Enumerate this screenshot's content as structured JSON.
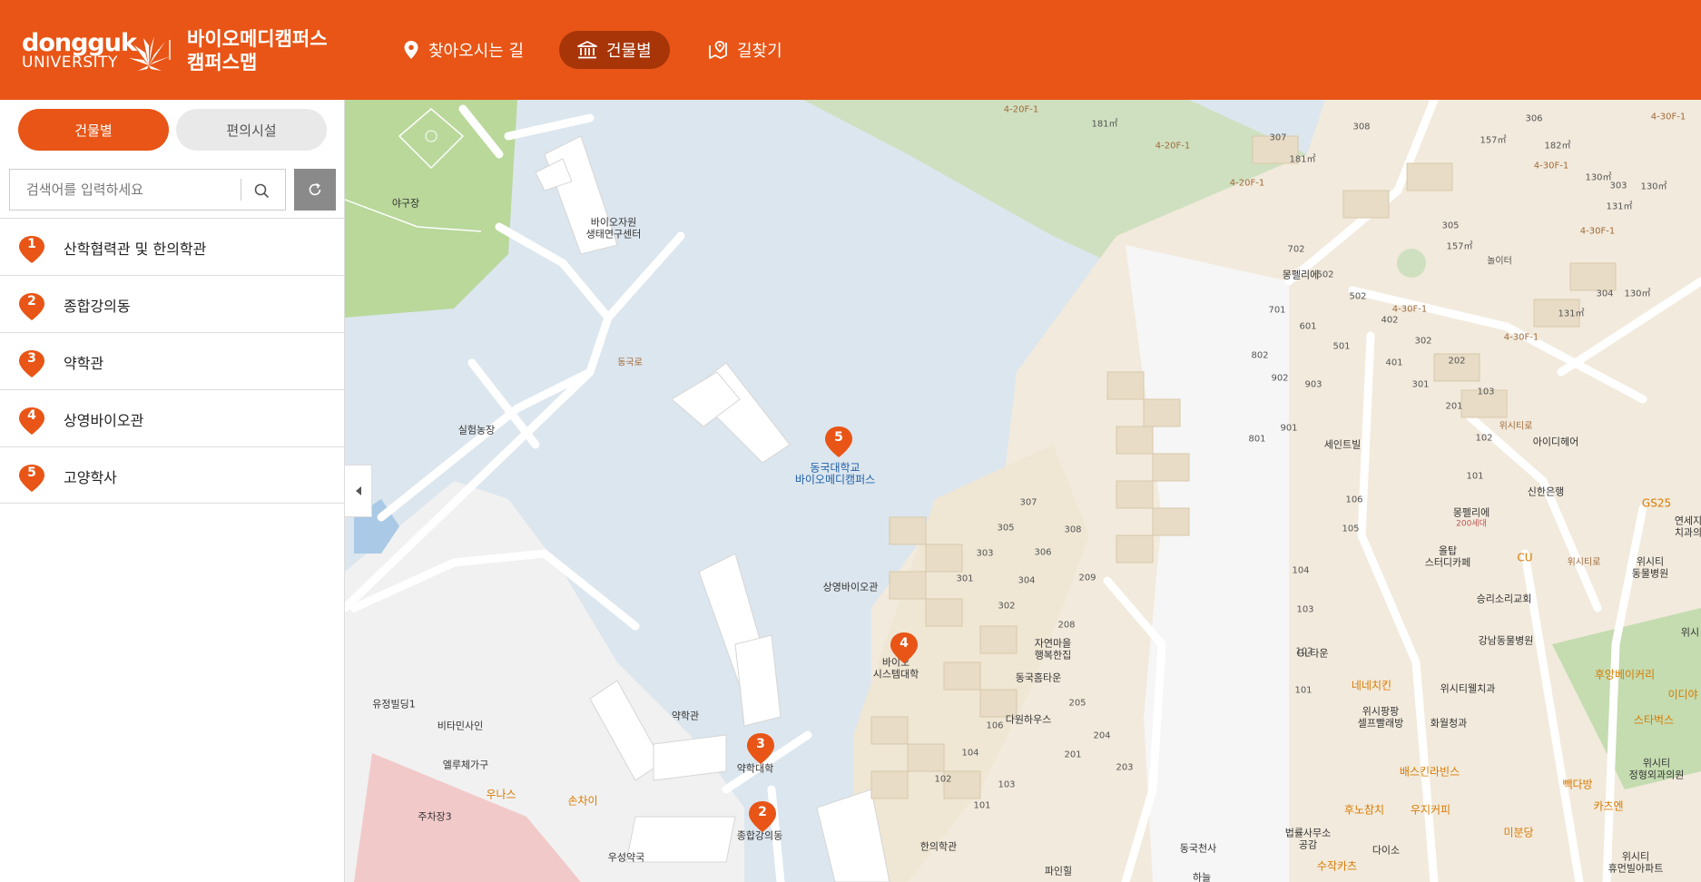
{
  "header": {
    "logo_main": "dongguk",
    "logo_sub": "UNIVERSITY",
    "title_line1": "바이오메디캠퍼스",
    "title_line2": "캠퍼스맵",
    "nav": {
      "directions": "찾아오시는 길",
      "buildings": "건물별",
      "route": "길찾기"
    }
  },
  "sidebar": {
    "tabs": {
      "buildings": "건물별",
      "amenities": "편의시설"
    },
    "search_placeholder": "검색어를 입력하세요",
    "items": [
      {
        "num": "1",
        "label": "산학협력관 및 한의학관"
      },
      {
        "num": "2",
        "label": "종합강의동"
      },
      {
        "num": "3",
        "label": "약학관"
      },
      {
        "num": "4",
        "label": "상영바이오관"
      },
      {
        "num": "5",
        "label": "고양학사"
      }
    ]
  },
  "map": {
    "markers": [
      "5",
      "4",
      "3",
      "2"
    ],
    "labels": {
      "baseball": "야구장",
      "bio_res1": "바이오자원",
      "bio_res2": "생태연구센터",
      "farm": "실험농장",
      "campus1": "동국대학교",
      "campus2": "바이오메디캠퍼스",
      "sangyoung": "상영바이오관",
      "biosys1": "바이오",
      "biosys2": "시스템대학",
      "pharm_hall": "약학관",
      "pharm_college": "약학대학",
      "lecture": "종합강의동",
      "oriental": "한의학관",
      "yujeong": "유정빌딩1",
      "vitamin": "비타민사인",
      "elle": "엘루체가구",
      "unas": "우나스",
      "sonchai": "손차이",
      "parking": "주차장3",
      "woosung": "우성약국",
      "dongguk_rd": "동국로",
      "jayeon1": "자연마을",
      "jayeon2": "행복한집",
      "donggukhome": "동국홈타운",
      "dawon": "다원하우스",
      "dongguk_church": "동국천사",
      "pine": "파인힐",
      "law1": "법률사무소",
      "law2": "공감",
      "daiso": "다이소",
      "sujak": "수작카츠",
      "montpellier": "몽펠리에",
      "montpellier200": "몽펠리에",
      "montpellier200_sub": "200세대",
      "seintrill": "세인트빌",
      "idhair": "아이디헤어",
      "shinhan": "신한은행",
      "gs25": "GS25",
      "cu": "CU",
      "olltap1": "올탑",
      "olltap2": "스터디카페",
      "wisity_animal1": "위시티",
      "wisity_animal2": "동물병원",
      "seungri": "승리소리교회",
      "gangnam_animal": "강남동물병원",
      "gl": "GL타운",
      "nene": "네네치킨",
      "wisity_welfare": "위시티웰치과",
      "wisipang1": "위시팡팡",
      "wisipang2": "셀프빨래방",
      "hwawol": "화월청과",
      "baskin": "배스킨라빈스",
      "hunorangji": "후노참치",
      "woojicoffee": "우지커피",
      "bbakdabang": "빽다방",
      "mibundang": "미분당",
      "katsuen": "카츠엔",
      "starbucks": "스타벅스",
      "wisity_ortho1": "위시티",
      "wisity_ortho2": "정형외과의원",
      "hubang": "후앙베이커리",
      "idiya": "이디야",
      "wisity_apt1": "위시티",
      "wisity_apt2": "휴먼빌아파트",
      "playground": "놀이터",
      "wisi_rd": "위시티로",
      "wisi_rd2": "위시티로",
      "yeonse1": "연세지",
      "yeonse2": "치과의",
      "wisi_edge": "위시",
      "hanul": "하늘"
    },
    "road_tags": [
      "4-20F-1",
      "4-20F-1",
      "4-30F-1",
      "4-20F-1",
      "4-30F-1",
      "4-30F-1",
      "4-30F-1",
      "4-30F-1"
    ],
    "unit_numbers": [
      "702",
      "502",
      "502",
      "402",
      "701",
      "601",
      "501",
      "302",
      "401",
      "202",
      "802",
      "902",
      "903",
      "301",
      "201",
      "103",
      "801",
      "901",
      "102",
      "101",
      "106",
      "105",
      "104",
      "103",
      "102",
      "101",
      "307",
      "305",
      "308",
      "303",
      "306",
      "301",
      "304",
      "209",
      "302",
      "208",
      "205",
      "106",
      "204",
      "104",
      "201",
      "203",
      "102",
      "103",
      "101",
      "308",
      "306",
      "307",
      "305",
      "303",
      "304"
    ],
    "area_tags": [
      "181㎡",
      "181㎡",
      "157㎡",
      "182㎡",
      "157㎡",
      "131㎡",
      "130㎡",
      "130㎡",
      "131㎡",
      "130㎡"
    ]
  },
  "colors": {
    "brand": "#e85516",
    "brand_dark": "#a83508",
    "water": "#dce6ee",
    "grass": "#c4dcb0",
    "residential": "#f0e6d6",
    "road": "#ffffff"
  }
}
